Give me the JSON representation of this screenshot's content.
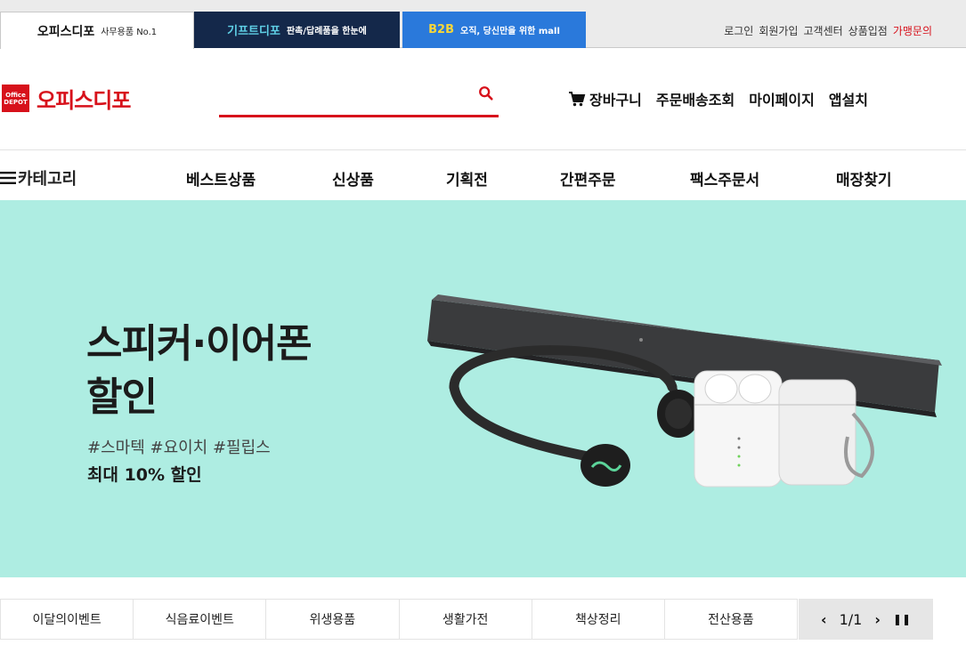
{
  "site_tabs": [
    {
      "name": "오피스디포",
      "sub": "사무용품 No.1"
    },
    {
      "name": "기프트디포",
      "sub": "판촉/답례품을 한눈에"
    },
    {
      "name": "B2B",
      "sub": "오직, 당신만을 위한 mall"
    }
  ],
  "util_links": [
    "로그인",
    "회원가입",
    "고객센터",
    "상품입점",
    "가맹문의"
  ],
  "logo": {
    "box_line1": "Office",
    "box_line2": "DEPOT",
    "text": "오피스디포"
  },
  "search": {
    "value": "",
    "placeholder": ""
  },
  "header_links": [
    "장바구니",
    "주문배송조회",
    "마이페이지",
    "앱설치"
  ],
  "category_label": "카테고리",
  "nav": [
    "베스트상품",
    "신상품",
    "기획전",
    "간편주문",
    "팩스주문서",
    "매장찾기"
  ],
  "banner": {
    "title_line1": "스피커·이어폰",
    "title_line2": "할인",
    "tags": "#스마텍 #요이치 #필립스",
    "subtitle": "최대 10% 할인",
    "bg_color": "#aeede2"
  },
  "bottom_tabs": [
    "이달의이벤트",
    "식음료이벤트",
    "위생용품",
    "생활가전",
    "책상정리",
    "전산용품"
  ],
  "pager": {
    "prev": "‹",
    "current": "1/1",
    "next": "›",
    "pause": "❚❚"
  },
  "colors": {
    "brand_red": "#d7111b",
    "gift_navy": "#14284a",
    "b2b_blue": "#2a79db"
  }
}
